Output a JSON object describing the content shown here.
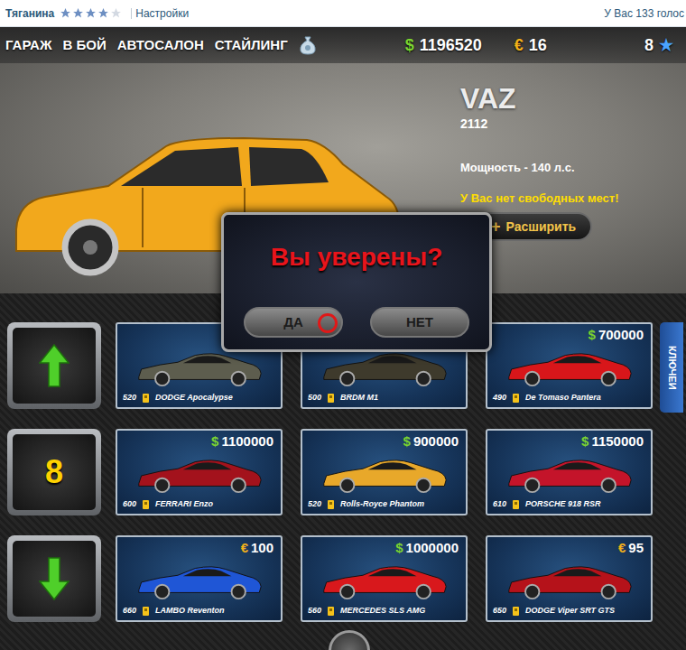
{
  "top_bar": {
    "user": "Тяганина",
    "stars": 4,
    "settings": "Настройки",
    "votes": "У Вас 133 голос"
  },
  "nav": {
    "items": [
      {
        "label": "ГАРАЖ"
      },
      {
        "label": "В БОЙ"
      },
      {
        "label": "АВТОСАЛОН"
      },
      {
        "label": "СТАЙЛИНГ"
      }
    ],
    "money": {
      "symbol": "$",
      "value": "1196520"
    },
    "euro": {
      "symbol": "€",
      "value": "16"
    },
    "level": {
      "value": "8",
      "symbol": "★"
    }
  },
  "car": {
    "make": "VAZ",
    "model": "2112",
    "power": "Мощность - 140 л.с.",
    "warning": "У Вас нет свободных мест!",
    "expand": {
      "icon": "+",
      "label": "Расширить"
    },
    "color": "#f2a81c"
  },
  "dialog": {
    "title": "Вы уверены?",
    "buttons": [
      {
        "label": "ДА",
        "hovered": true
      },
      {
        "label": "НЕТ",
        "hovered": false
      }
    ]
  },
  "pager": {
    "page": "8"
  },
  "side_tab": "КЛЮЧЕИ",
  "shop": [
    {
      "name": "DODGE Apocalypse",
      "power": "520",
      "currency": "$",
      "color": "#5d5d4e"
    },
    {
      "name": "BRDM M1",
      "power": "500",
      "color": "#3e3a2c"
    },
    {
      "name": "De Tomaso Pantera",
      "power": "490",
      "currency": "$",
      "price": "700000",
      "color": "#d8161a"
    },
    {
      "name": "FERRARI Enzo",
      "power": "600",
      "currency": "$",
      "price": "1100000",
      "color": "#a3121c"
    },
    {
      "name": "Rolls-Royce Phantom",
      "power": "520",
      "currency": "$",
      "price": "900000",
      "color": "#e8a82a"
    },
    {
      "name": "PORSCHE 918 RSR",
      "power": "610",
      "currency": "$",
      "price": "1150000",
      "color": "#c4142a"
    },
    {
      "name": "LAMBO Reventon",
      "power": "660",
      "currency": "€",
      "price": "100",
      "color": "#1f56d6"
    },
    {
      "name": "MERCEDES SLS AMG",
      "power": "560",
      "currency": "$",
      "price": "1000000",
      "color": "#d8181c"
    },
    {
      "name": "DODGE Viper SRT GTS",
      "power": "650",
      "currency": "€",
      "price": "95",
      "color": "#b5121a"
    }
  ]
}
